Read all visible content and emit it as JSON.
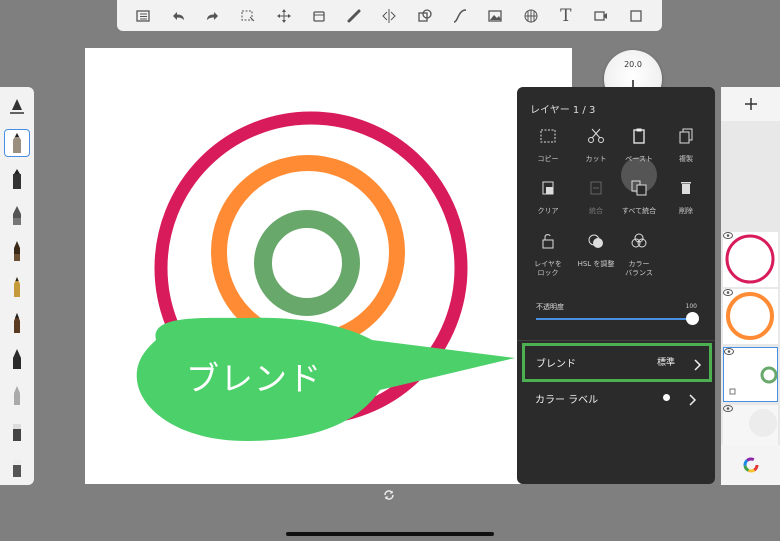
{
  "toolbar": {
    "icons": [
      "list-icon",
      "undo-icon",
      "redo-icon",
      "select-icon",
      "move-icon",
      "layer-tool-icon",
      "ruler-icon",
      "symmetry-icon",
      "shapes-icon",
      "curve-icon",
      "image-icon",
      "perspective-icon",
      "text-icon",
      "video-icon",
      "fullscreen-icon"
    ],
    "text_tool_label": "T"
  },
  "brush_size": {
    "value": "20.0"
  },
  "layer_panel": {
    "title": "レイヤー 1 / 3",
    "actions": [
      {
        "label": "コピー"
      },
      {
        "label": "カット"
      },
      {
        "label": "ペースト"
      },
      {
        "label": "複製"
      },
      {
        "label": "クリア"
      },
      {
        "label": "統合"
      },
      {
        "label": "すべて統合"
      },
      {
        "label": "削除"
      },
      {
        "label": "レイヤを\nロック"
      },
      {
        "label": "HSL を調整"
      },
      {
        "label": "カラー\nバランス"
      }
    ],
    "opacity_label": "不透明度",
    "opacity_value": "100",
    "opacity_fraction": 1.0,
    "blend_label": "ブレンド",
    "blend_value": "標準",
    "color_label_label": "カラー ラベル"
  },
  "callout": {
    "text": "ブレンド"
  },
  "colors": {
    "ring_outer": "#d81b5a",
    "ring_middle": "#ff8c34",
    "ring_inner": "#69a86b",
    "bubble": "#4cd06a",
    "highlight": "#4caf50",
    "accent": "#4a90e2"
  }
}
